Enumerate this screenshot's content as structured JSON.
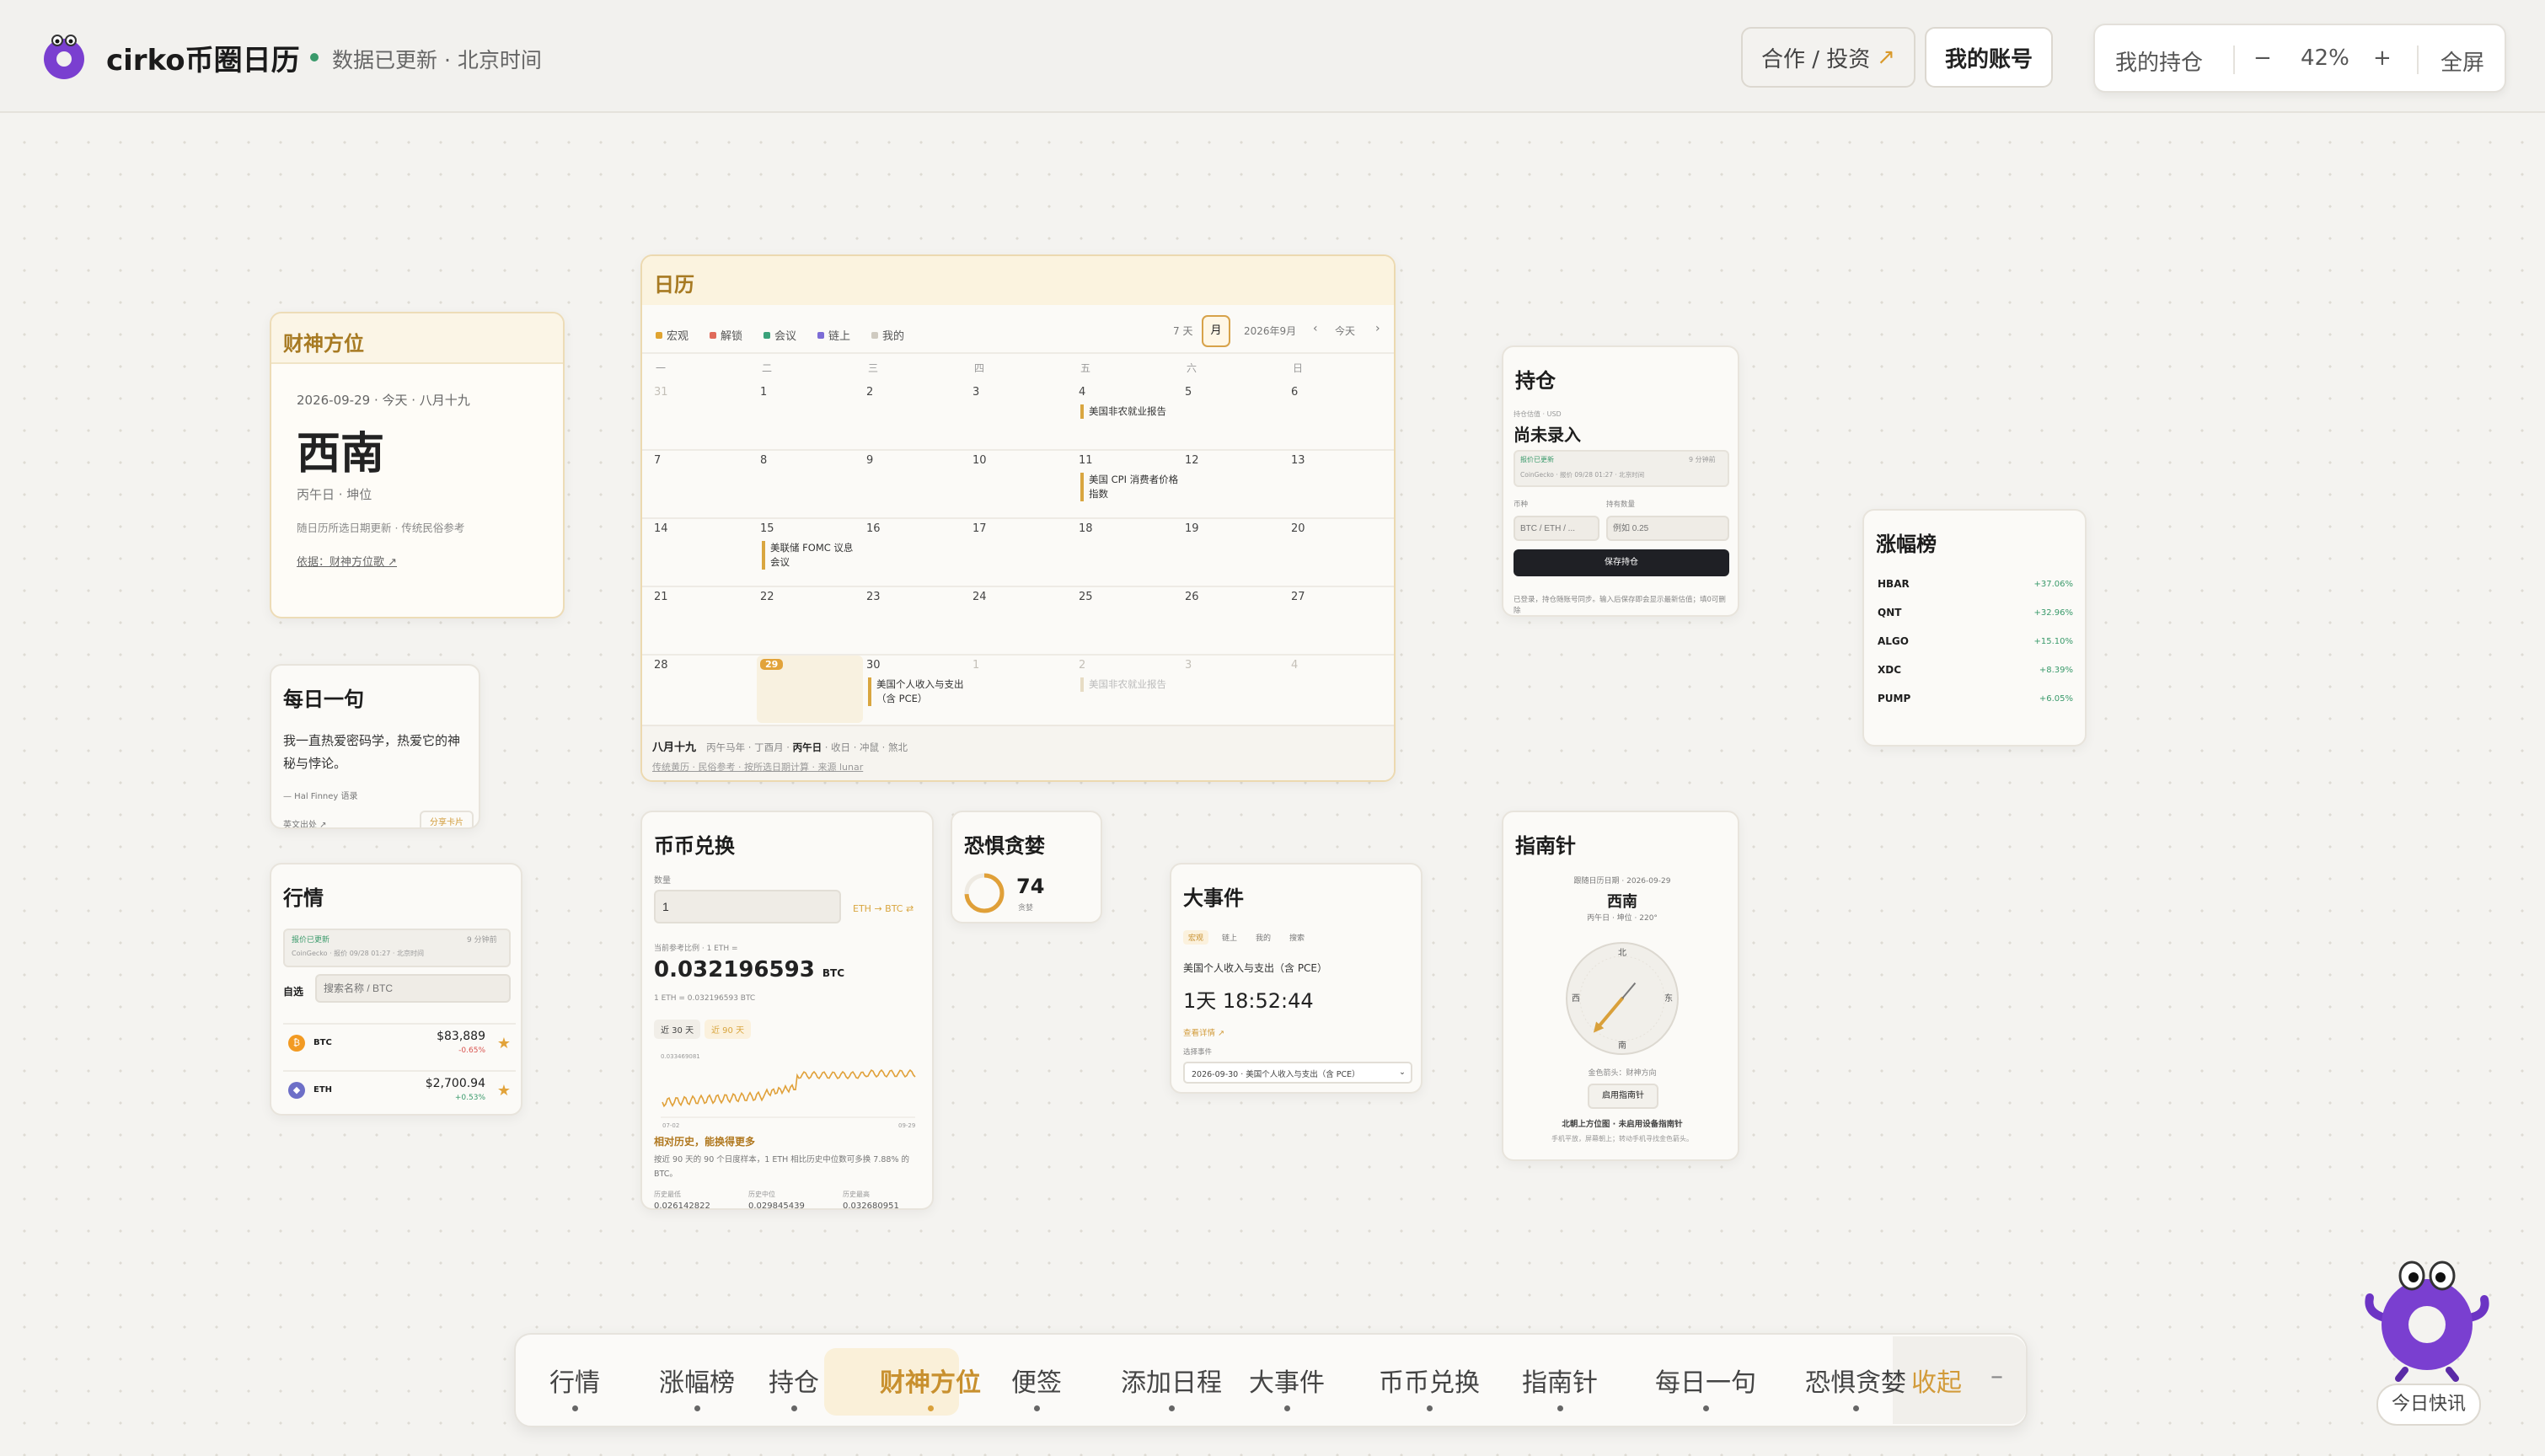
{
  "header": {
    "brand": "cirko币圈日历",
    "status": "数据已更新 · 北京时间",
    "coop": "合作 / 投资",
    "coop_arrow": "↗",
    "account": "我的账号",
    "holdings": "我的持仓",
    "zoom_minus": "−",
    "zoom": "42%",
    "zoom_plus": "+",
    "fullscreen": "全屏"
  },
  "caishen": {
    "title": "财神方位",
    "date": "2026-09-29 · 今天 · 八月十九",
    "direction": "西南",
    "ganzhi": "丙午日 · 坤位",
    "note": "随日历所选日期更新 · 传统民俗参考",
    "basis": "依据：财神方位歌 ↗"
  },
  "calendar": {
    "title": "日历",
    "legend": [
      "宏观",
      "解锁",
      "会议",
      "链上",
      "我的"
    ],
    "legend_colors": [
      "#e0a431",
      "#e06a5a",
      "#3aa27a",
      "#7c6cd6",
      "#cfcac0"
    ],
    "view_week": "7 天",
    "view_month": "月",
    "month": "2026年9月",
    "prev": "‹",
    "today": "今天",
    "next": "›",
    "weekdays": [
      "一",
      "二",
      "三",
      "四",
      "五",
      "六",
      "日"
    ],
    "days": [
      {
        "d": "31",
        "dim": true
      },
      {
        "d": "1"
      },
      {
        "d": "2"
      },
      {
        "d": "3"
      },
      {
        "d": "4",
        "ev": "美国非农就业报告"
      },
      {
        "d": "5"
      },
      {
        "d": "6"
      },
      {
        "d": "7"
      },
      {
        "d": "8"
      },
      {
        "d": "9"
      },
      {
        "d": "10"
      },
      {
        "d": "11",
        "ev": "美国 CPI 消费者价格指数"
      },
      {
        "d": "12"
      },
      {
        "d": "13"
      },
      {
        "d": "14"
      },
      {
        "d": "15",
        "ev": "美联储 FOMC 议息会议"
      },
      {
        "d": "16"
      },
      {
        "d": "17"
      },
      {
        "d": "18"
      },
      {
        "d": "19"
      },
      {
        "d": "20"
      },
      {
        "d": "21"
      },
      {
        "d": "22"
      },
      {
        "d": "23"
      },
      {
        "d": "24"
      },
      {
        "d": "25"
      },
      {
        "d": "26"
      },
      {
        "d": "27"
      },
      {
        "d": "28"
      },
      {
        "d": "29",
        "today": true
      },
      {
        "d": "30",
        "ev": "美国个人收入与支出（含 PCE）"
      },
      {
        "d": "1",
        "dim": true
      },
      {
        "d": "2",
        "dim": true,
        "ev": "美国非农就业报告",
        "evdim": true
      },
      {
        "d": "3",
        "dim": true
      },
      {
        "d": "4",
        "dim": true
      }
    ],
    "footer_lunar": "八月十九",
    "footer_ganzhi": "丙午马年 · 丁酉月 · ",
    "footer_day": "丙午日",
    "footer_rest": " · 收日 · 冲鼠 · 煞北",
    "footer_note": "传统黄历 · 民俗参考 · 按所选日期计算 · 来源 lunar"
  },
  "daily": {
    "title": "每日一句",
    "quote": "我一直热爱密码学，热爱它的神秘与悖论。",
    "author": "— Hal Finney 语录",
    "orig": "英文出处 ↗",
    "share": "分享卡片"
  },
  "market": {
    "title": "行情",
    "refresh": "报价已更新",
    "refresh_sub": "CoinGecko · 报价 09/28 01:27 · 北京时间",
    "interval": "9 分钟前",
    "tab": "自选",
    "search_ph": "搜索名称 / BTC",
    "coins": [
      {
        "sym": "BTC",
        "price": "$83,889",
        "chg": "-0.65%",
        "color": "#f29a22"
      },
      {
        "sym": "ETH",
        "price": "$2,700.94",
        "chg": "+0.53%",
        "color": "#6d6fc7"
      }
    ]
  },
  "convert": {
    "title": "币币兑换",
    "qty_label": "数量",
    "qty": "1",
    "pair": "ETH → BTC ⇄",
    "rate_label": "当前参考比例 · 1 ETH =",
    "rate": "0.032196593",
    "unit": "BTC",
    "rate_sub": "1 ETH = 0.032196593 BTC",
    "tab30": "近 30 天",
    "tab90": "近 90 天",
    "ymax": "0.033469081",
    "xstart": "07-02",
    "xend": "09-29",
    "hist_title": "相对历史，能换得更多",
    "hist_text": "按近 90 天的 90 个日度样本，1 ETH 相比历史中位数可多换 7.88% 的 BTC。",
    "stat_labels": [
      "历史最低",
      "历史中位",
      "历史最高"
    ],
    "stat_values": [
      "0.026142822",
      "0.029845439",
      "0.032680951"
    ]
  },
  "fear": {
    "title": "恐惧贪婪",
    "value": "74",
    "label": "贪婪",
    "progress": 0.74
  },
  "event": {
    "title": "大事件",
    "tabs": [
      "宏观",
      "链上",
      "我的",
      "搜索"
    ],
    "name": "美国个人收入与支出（含 PCE）",
    "countdown": "1天 18:52:44",
    "link": "查看详情 ↗",
    "select_label": "选择事件",
    "select": "2026-09-30 · 美国个人收入与支出（含 PCE）"
  },
  "holdings": {
    "title": "持仓",
    "sub": "持仓估值 · USD",
    "value": "尚未录入",
    "refresh": "报价已更新",
    "refresh_sub": "CoinGecko · 报价 09/28 01:27 · 北京时间",
    "interval": "9 分钟前",
    "coin_label": "币种",
    "amount_label": "持有数量",
    "coin_ph": "BTC / ETH / ...",
    "amount_ph": "例如 0.25",
    "save": "保存持仓",
    "note": "已登录，持仓随账号同步。输入后保存即会显示最新估值；填0可删除"
  },
  "compass": {
    "title": "指南针",
    "sub": "跟随日历日期 · 2026-09-29",
    "dir": "西南",
    "info": "丙午日 · 坤位 · 220°",
    "dirs": [
      "北",
      "东",
      "南",
      "西"
    ],
    "caption": "金色箭头：财神方向",
    "button": "启用指南针",
    "hint": "北朝上方位图 · 未启用设备指南针",
    "hint2": "手机平放，屏幕朝上；转动手机寻找金色箭头。",
    "heading": 220
  },
  "gainers": {
    "title": "涨幅榜",
    "items": [
      {
        "sym": "HBAR",
        "chg": "+37.06%"
      },
      {
        "sym": "QNT",
        "chg": "+32.96%"
      },
      {
        "sym": "ALGO",
        "chg": "+15.10%"
      },
      {
        "sym": "XDC",
        "chg": "+8.39%"
      },
      {
        "sym": "PUMP",
        "chg": "+6.05%"
      }
    ]
  },
  "nav": {
    "items": [
      "行情",
      "涨幅榜",
      "持仓",
      "财神方位",
      "便签",
      "添加日程",
      "大事件",
      "币币兑换",
      "指南针",
      "每日一句",
      "恐惧贪婪"
    ],
    "collapse": "收起",
    "collapse_icon": "–",
    "active": "财神方位"
  },
  "fab": {
    "label": "今日快讯"
  }
}
